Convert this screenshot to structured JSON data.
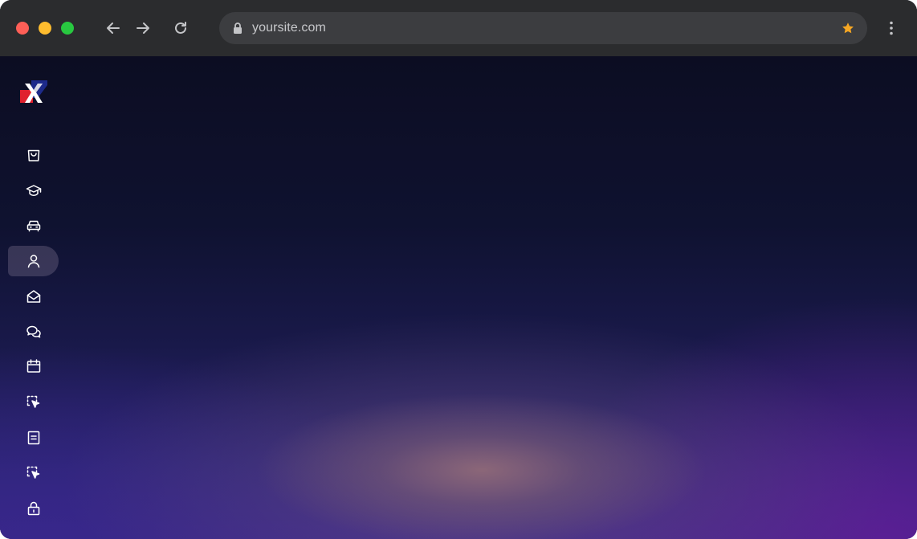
{
  "browser": {
    "url": "yoursite.com",
    "bookmark_color": "#f5a623"
  },
  "sidebar": {
    "items": [
      {
        "icon": "shopping-bag-icon",
        "active": false
      },
      {
        "icon": "graduation-cap-icon",
        "active": false
      },
      {
        "icon": "car-icon",
        "active": false
      },
      {
        "icon": "user-icon",
        "active": true
      },
      {
        "icon": "mail-open-icon",
        "active": false
      },
      {
        "icon": "chat-bubbles-icon",
        "active": false
      },
      {
        "icon": "calendar-icon",
        "active": false
      },
      {
        "icon": "selection-cursor-icon",
        "active": false
      },
      {
        "icon": "document-icon",
        "active": false
      },
      {
        "icon": "selection-cursor-icon",
        "active": false
      },
      {
        "icon": "lock-icon",
        "active": false
      }
    ]
  },
  "colors": {
    "chrome_bg": "#2b2c2e",
    "omnibox_bg": "#3c3d40",
    "page_top": "#0c0d22",
    "page_bottom": "#3a2488",
    "logo_red": "#e0212e",
    "logo_navy": "#1d2a8a"
  }
}
